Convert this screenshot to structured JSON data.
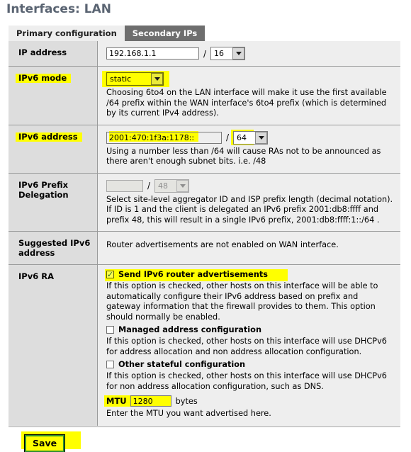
{
  "page": {
    "title": "Interfaces: LAN"
  },
  "tabs": [
    {
      "label": "Primary configuration",
      "active": true
    },
    {
      "label": "Secondary IPs",
      "active": false
    }
  ],
  "form": {
    "ip_address": {
      "label": "IP address",
      "value": "192.168.1.1",
      "prefix": "16",
      "separator": "/"
    },
    "ipv6_mode": {
      "label": "IPv6 mode",
      "value": "static",
      "description": "Choosing 6to4 on the LAN interface will make it use the first available /64 prefix within the WAN interface's 6to4 prefix (which is determined by its current IPv4 address)."
    },
    "ipv6_address": {
      "label": "IPv6 address",
      "value": "2001:470:1f3a:1178::",
      "prefix": "64",
      "separator": "/",
      "description": "Using a number less than /64 will cause RAs not to be announced as there aren't enough subnet bits. i.e. /48"
    },
    "ipv6_prefix_delegation": {
      "label": "IPv6 Prefix Delegation",
      "value": "",
      "prefix": "48",
      "separator": "/",
      "description_line1": "Select site-level aggregator ID and ISP prefix length (decimal notation).",
      "description_line2": "If ID is 1 and the client is delegated an IPv6 prefix 2001:db8:ffff and prefix 48, this will result in a single IPv6 prefix, 2001:db8:ffff:1::/64 ."
    },
    "suggested_ipv6_address": {
      "label": "Suggested IPv6 address",
      "text": "Router advertisements are not enabled on WAN interface."
    },
    "ipv6_ra": {
      "label": "IPv6 RA",
      "send_ra": {
        "label": "Send IPv6 router advertisements",
        "checked": true,
        "checkmark": "✓",
        "description": "If this option is checked, other hosts on this interface will be able to automatically configure their IPv6 address based on prefix and gateway information that the firewall provides to them. This option should normally be enabled."
      },
      "managed_address": {
        "label": "Managed address configuration",
        "checked": false,
        "description": "If this option is checked, other hosts on this interface will use DHCPv6 for address allocation and non address allocation configuration."
      },
      "other_stateful": {
        "label": "Other stateful configuration",
        "checked": false,
        "description": "If this option is checked, other hosts on this interface will use DHCPv6 for non address allocation configuration, such as DNS."
      },
      "mtu": {
        "label": "MTU",
        "value": "1280",
        "units": "bytes",
        "description": "Enter the MTU you want advertised here."
      }
    }
  },
  "actions": {
    "save_label": "Save"
  },
  "colors": {
    "highlight": "#ffff00",
    "tab_active_bg": "#eeeeee",
    "tab_inactive_bg": "#6e6e6e",
    "label_col_bg": "#dddddd",
    "field_col_bg": "#eeeeee",
    "title_text": "#5a6472",
    "save_border": "#2f8f2f"
  }
}
